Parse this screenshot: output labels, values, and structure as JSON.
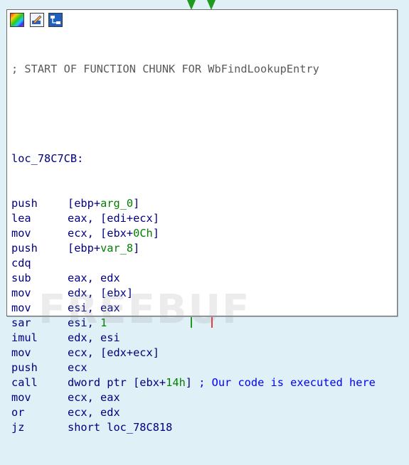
{
  "colors": {
    "background": "#dff0f6",
    "node_bg": "#ffffff",
    "instruction": "#000080",
    "immediate": "#008000",
    "comment": "#0000ff",
    "chunk_comment": "#5a5a5a",
    "true_edge": "#1f9a1f",
    "false_edge": "#e04040"
  },
  "toolbar": {
    "icons": [
      "set-node-color-icon",
      "rename-icon",
      "group-nodes-icon"
    ]
  },
  "code": {
    "chunk_comment": "; START OF FUNCTION CHUNK FOR WbFindLookupEntry",
    "label": "loc_78C7CB:",
    "instructions": [
      {
        "mnem": "push",
        "ops": "[ebp+",
        "ops_green": "arg_0",
        "ops_tail": "]"
      },
      {
        "mnem": "lea",
        "ops": "eax, [edi+ecx]"
      },
      {
        "mnem": "mov",
        "ops": "ecx, [ebx+",
        "ops_green": "0Ch",
        "ops_tail": "]"
      },
      {
        "mnem": "push",
        "ops": "[ebp+",
        "ops_green": "var_8",
        "ops_tail": "]"
      },
      {
        "mnem": "cdq",
        "ops": ""
      },
      {
        "mnem": "sub",
        "ops": "eax, edx"
      },
      {
        "mnem": "mov",
        "ops": "edx, [ebx]"
      },
      {
        "mnem": "mov",
        "ops": "esi, eax"
      },
      {
        "mnem": "sar",
        "ops": "esi, ",
        "ops_green": "1",
        "ops_tail": ""
      },
      {
        "mnem": "imul",
        "ops": "edx, esi"
      },
      {
        "mnem": "mov",
        "ops": "ecx, [edx+ecx]"
      },
      {
        "mnem": "push",
        "ops": "ecx"
      },
      {
        "mnem": "call",
        "ops": "dword ptr [ebx+",
        "ops_green": "14h",
        "ops_tail": "] ",
        "comment": "; Our code is executed here"
      },
      {
        "mnem": "mov",
        "ops": "ecx, eax"
      },
      {
        "mnem": "or",
        "ops": "ecx, edx"
      },
      {
        "mnem": "jz",
        "ops": "short loc_78C818"
      }
    ]
  },
  "watermark": "FREEBUF"
}
